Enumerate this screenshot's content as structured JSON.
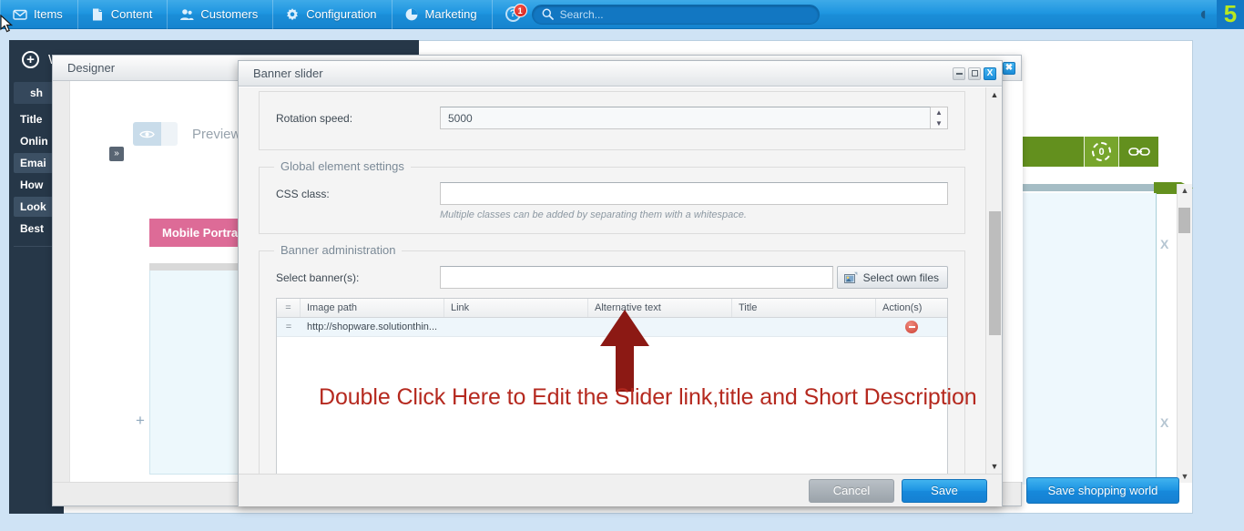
{
  "topbar": {
    "nav": [
      {
        "label": "Items",
        "icon": "inbox-icon"
      },
      {
        "label": "Content",
        "icon": "page-icon"
      },
      {
        "label": "Customers",
        "icon": "people-icon"
      },
      {
        "label": "Configuration",
        "icon": "gear-icon"
      },
      {
        "label": "Marketing",
        "icon": "pie-icon"
      }
    ],
    "help_badge": "1",
    "search_placeholder": "Search...",
    "search_value": "",
    "logo_letter": "5",
    "accent": "#1b8ed8"
  },
  "background_page": {
    "header_title": "W",
    "sidebar": {
      "top_label": "sh",
      "items": [
        {
          "label": "Title",
          "selected": false
        },
        {
          "label": "Onlin",
          "selected": false
        },
        {
          "label": "Emai",
          "selected": true
        },
        {
          "label": "How",
          "selected": false
        },
        {
          "label": "Look",
          "selected": true
        },
        {
          "label": "Best",
          "selected": false
        }
      ]
    },
    "green_count": "0",
    "x_marks": [
      "X",
      "X"
    ],
    "save_shopping_world_label": "Save shopping world"
  },
  "designer_window": {
    "title": "Designer",
    "collapse_label": "»",
    "preview_label": "Preview",
    "eye_icon": "eye-icon",
    "refresh_icon": "refresh-icon",
    "viewport_tabs": [
      {
        "label": "Mobile Portrait"
      },
      {
        "label": ""
      }
    ],
    "add_element_label": "+"
  },
  "banner_dialog": {
    "title": "Banner slider",
    "window_controls": {
      "minimize": "minimize-icon",
      "maximize": "maximize-icon",
      "close": "X"
    },
    "rotation": {
      "label": "Rotation speed:",
      "value": "5000"
    },
    "global_element_settings": {
      "legend": "Global element settings",
      "css_class_label": "CSS class:",
      "css_class_value": "",
      "hint": "Multiple classes can be added by separating them with a whitespace."
    },
    "banner_administration": {
      "legend": "Banner administration",
      "select_label": "Select banner(s):",
      "select_value": "",
      "pick_button": "Select own files",
      "pick_icon": "image-picker-icon",
      "columns": [
        "=",
        "Image path",
        "Link",
        "Alternative text",
        "Title",
        "Action(s)"
      ],
      "rows": [
        {
          "handle": "=",
          "image_path": "http://shopware.solutionthin...",
          "link": "",
          "alt_text": "",
          "title": "",
          "action_icon": "delete-icon"
        }
      ]
    },
    "footer": {
      "cancel": "Cancel",
      "save": "Save"
    }
  },
  "annotation": {
    "text": "Double Click Here to Edit the Slider link,title and Short Description",
    "color": "#b5291f",
    "arrow": "up-arrow"
  }
}
